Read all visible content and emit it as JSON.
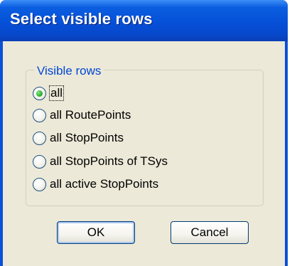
{
  "dialog": {
    "title": "Select visible rows"
  },
  "group": {
    "legend": "Visible rows",
    "options": [
      {
        "label": "all",
        "checked": true
      },
      {
        "label": "all RoutePoints",
        "checked": false
      },
      {
        "label": "all StopPoints",
        "checked": false
      },
      {
        "label": "all StopPoints of TSys",
        "checked": false
      },
      {
        "label": "all active StopPoints",
        "checked": false
      }
    ]
  },
  "buttons": {
    "ok": "OK",
    "cancel": "Cancel"
  },
  "colors": {
    "titlebar": "#0550d8",
    "client": "#ece9d8",
    "legend": "#0046d5",
    "radio_dot": "#2fb62f"
  }
}
